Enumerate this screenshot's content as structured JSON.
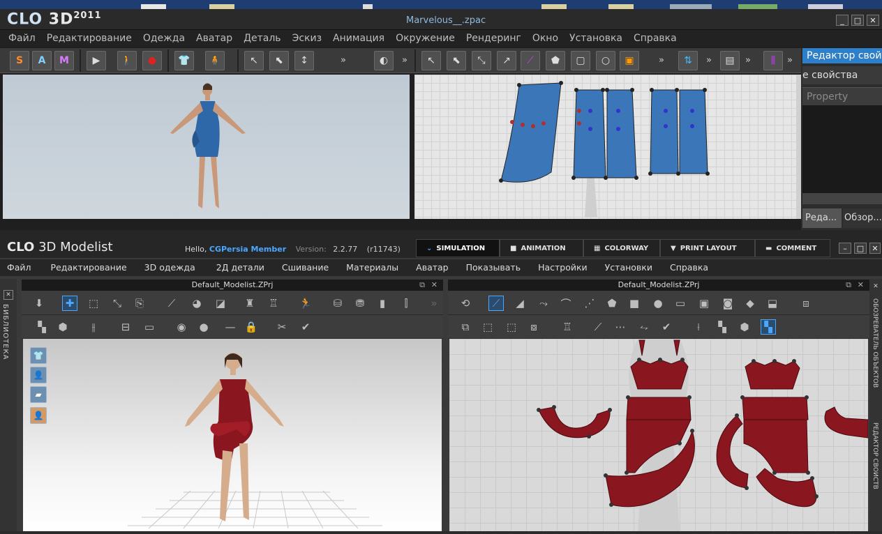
{
  "clo2011": {
    "logo": "CLO",
    "logo_3d": "3D",
    "logo_year": "2011",
    "title": "Marvelous__.zpac",
    "menu": [
      "Файл",
      "Редактирование",
      "Одежда",
      "Аватар",
      "Деталь",
      "Эскиз",
      "Анимация",
      "Окружение",
      "Рендеринг",
      "Окно",
      "Установка",
      "Справка"
    ],
    "toolbar": {
      "s_label": "S",
      "a_label": "A",
      "m_label": "M"
    },
    "prop_panel": {
      "title": "Редактор свойств",
      "subtitle": "е свойства",
      "column": "Property",
      "tab_edit": "Реда...",
      "tab_browse": "Обзор..."
    }
  },
  "modelist": {
    "logo": "CLO",
    "logo_rest": "3D Modelist",
    "hello": "Hello,",
    "user": "CGPersia Member",
    "version_label": "Version:",
    "version": "2.2.77",
    "revision": "(r11743)",
    "tabs": [
      {
        "icon": "simulation-icon",
        "label": "SIMULATION"
      },
      {
        "icon": "animation-icon",
        "label": "ANIMATION"
      },
      {
        "icon": "colorway-icon",
        "label": "COLORWAY"
      },
      {
        "icon": "print-layout-icon",
        "label": "PRINT LAYOUT"
      },
      {
        "icon": "comment-icon",
        "label": "COMMENT"
      }
    ],
    "menu": [
      "Файл",
      "Редактирование",
      "3D одежда",
      "2Д детали",
      "Сшивание",
      "Материалы",
      "Аватар",
      "Показывать",
      "Настройки",
      "Установки",
      "Справка"
    ],
    "left_panel_title": "Default_Modelist.ZPrj",
    "right_panel_title": "Default_Modelist.ZPrj",
    "library_label": "БИБЛИОТЕКА",
    "right_side_label_top": "ОБОЗРЕВАТЕЛЬ ОБЪЕКТОВ",
    "right_side_label_bottom": "РЕДАКТОР СВОЙСТВ"
  },
  "colors": {
    "dress_blue": "#3a76b8",
    "dress_red": "#8a1620",
    "accent_blue": "#4aa8ff"
  }
}
